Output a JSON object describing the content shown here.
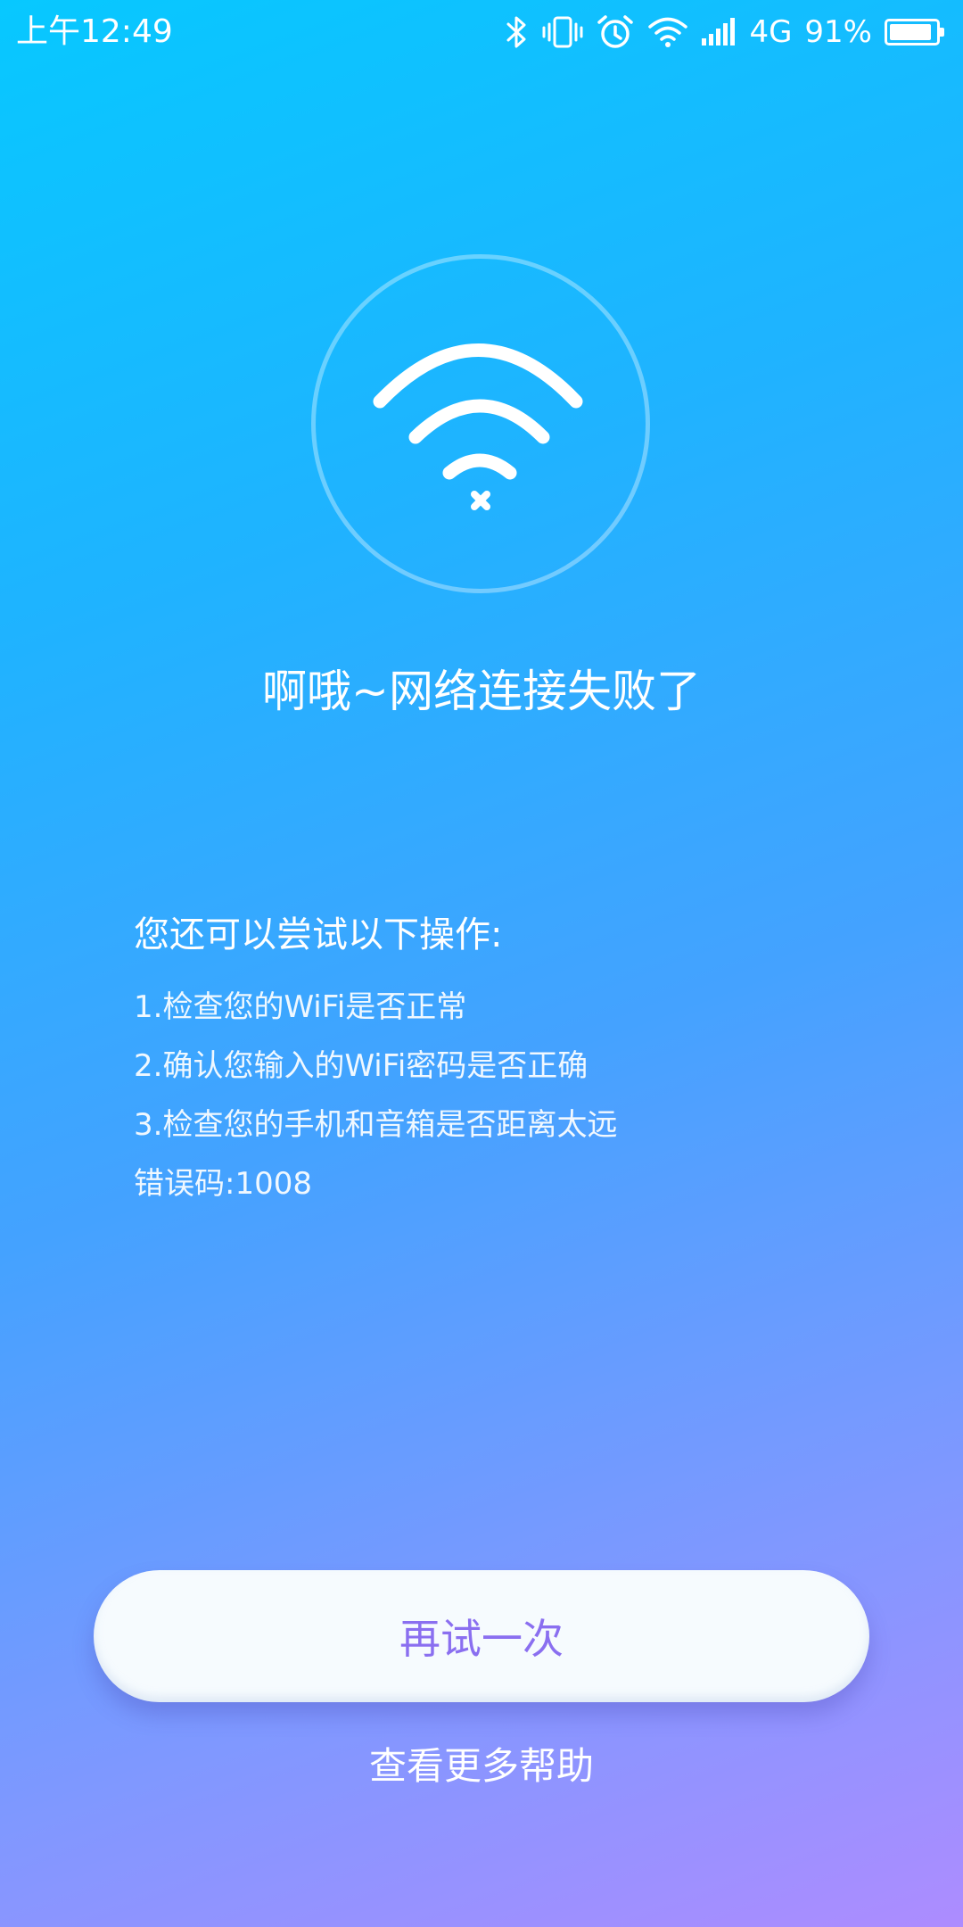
{
  "status_bar": {
    "time": "上午12:49",
    "network": "4G",
    "battery": "91%",
    "battery_level": 0.91,
    "icons": [
      "bluetooth-icon",
      "vibrate-icon",
      "alarm-icon",
      "wifi-icon",
      "signal-icon",
      "battery-icon"
    ]
  },
  "hero": {
    "icon": "wifi-disconnected-icon",
    "title": "啊哦~网络连接失败了"
  },
  "tips": {
    "heading": "您还可以尝试以下操作:",
    "items": [
      "1.检查您的WiFi是否正常",
      "2.确认您输入的WiFi密码是否正确",
      "3.检查您的手机和音箱是否距离太远"
    ],
    "error_code_label": "错误码:",
    "error_code": "1008"
  },
  "actions": {
    "retry_label": "再试一次",
    "help_label": "查看更多帮助"
  },
  "colors": {
    "gradient_top": "#07c8ff",
    "gradient_bottom": "#ad8cff",
    "button_text": "#8a6ff0",
    "button_bg": "#f6fbfe"
  }
}
